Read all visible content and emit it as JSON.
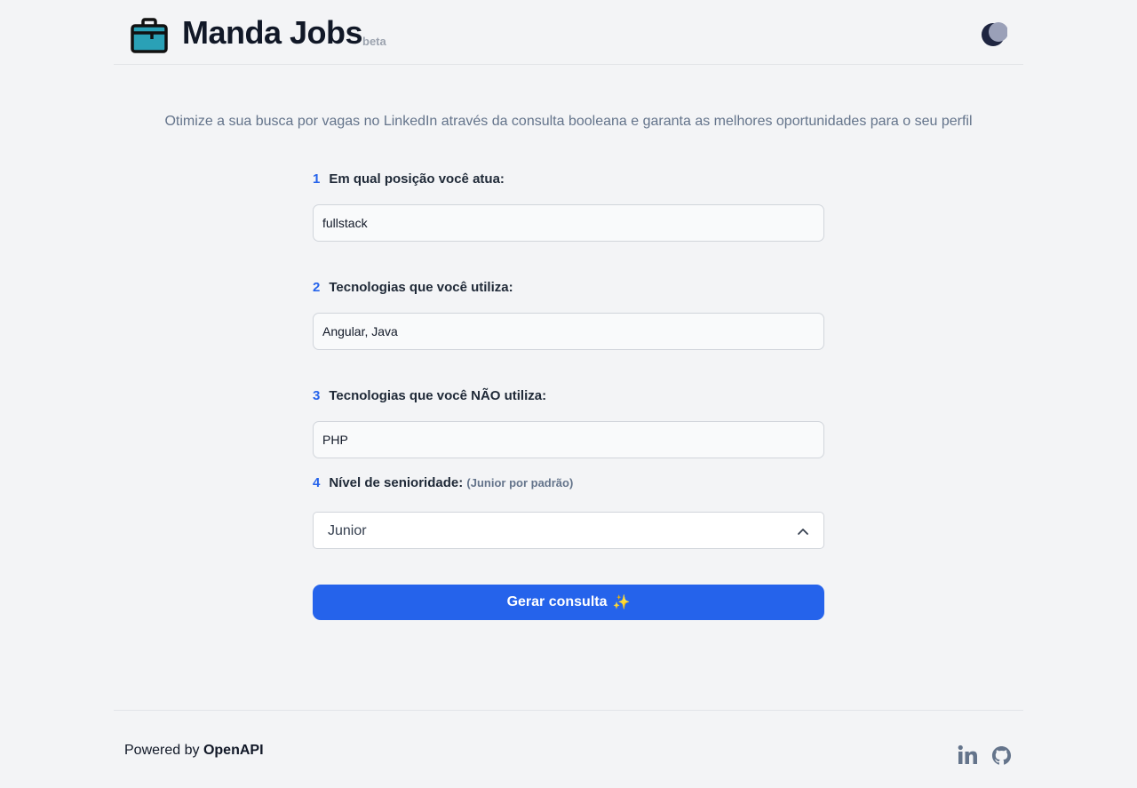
{
  "header": {
    "brand": "Manda Jobs",
    "badge": "beta",
    "icons": {
      "logo": "briefcase-icon",
      "theme": "moon-icon"
    }
  },
  "intro": "Otimize a sua busca por vagas no LinkedIn através da consulta booleana e garanta as melhores oportunidades para o seu perfil",
  "form": {
    "questions": [
      {
        "number": "1",
        "label": "Em qual posição você atua:",
        "value": "fullstack"
      },
      {
        "number": "2",
        "label": "Tecnologias que você utiliza:",
        "value": "Angular, Java"
      },
      {
        "number": "3",
        "label": "Tecnologias que você NÃO utiliza:",
        "value": "PHP"
      }
    ],
    "seniority": {
      "number": "4",
      "label": "Nível de senioridade:",
      "hint": "(Junior por padrão)",
      "selected": "Junior"
    },
    "submit_label": "Gerar consulta",
    "submit_emoji": "✨"
  },
  "footer": {
    "powered_prefix": "Powered by",
    "powered_brand": "OpenAPI",
    "icons": [
      "linkedin-icon",
      "github-icon"
    ]
  },
  "colors": {
    "accent": "#2563eb",
    "background": "#f3f4f6",
    "logo_teal": "#2aa1b6"
  }
}
